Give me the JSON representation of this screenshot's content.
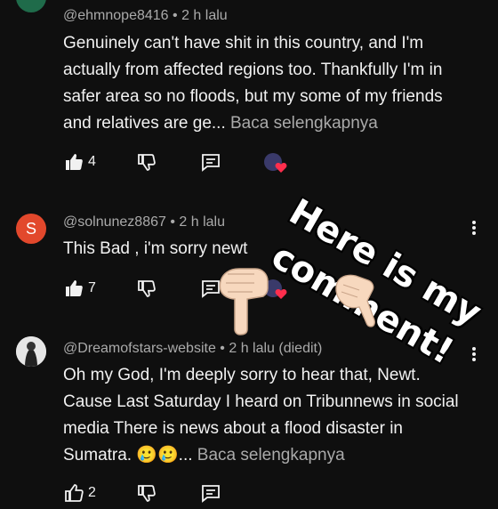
{
  "comments": [
    {
      "author": "@ehmnope8416",
      "sep": "•",
      "time": "2 h lalu",
      "text": "Genuinely can't have shit in this country, and I'm actually from affected regions too. Thankfully I'm in safer area so no floods, but my some of my friends and relatives are ge...",
      "read_more": "Baca selengkapnya",
      "likes": "4"
    },
    {
      "author": "@solnunez8867",
      "sep": "•",
      "time": "2 h lalu",
      "avatar_letter": "S",
      "text": "This Bad , i'm sorry newt",
      "likes": "7"
    },
    {
      "author": "@Dreamofstars-website",
      "sep": "•",
      "time": "2 h lalu (diedit)",
      "text": "Oh my God, I'm deeply sorry to hear that, Newt. Cause Last Saturday I heard on Tribunnews in social media There is news about a flood disaster in Sumatra. 🥲🥲...",
      "read_more": "Baca selengkapnya",
      "likes": "2"
    }
  ],
  "overlay": {
    "line1": "Here is my",
    "line2": "comment!"
  },
  "colors": {
    "background": "#0f0f0f",
    "text": "#f1f1f1",
    "secondary": "#aaaaaa",
    "avatar_s": "#e2482c",
    "heart": "#ff2e4d"
  },
  "icons": [
    "like-icon",
    "dislike-icon",
    "reply-icon",
    "more-vert-icon",
    "creator-heart-icon",
    "pointing-hand-icon"
  ]
}
